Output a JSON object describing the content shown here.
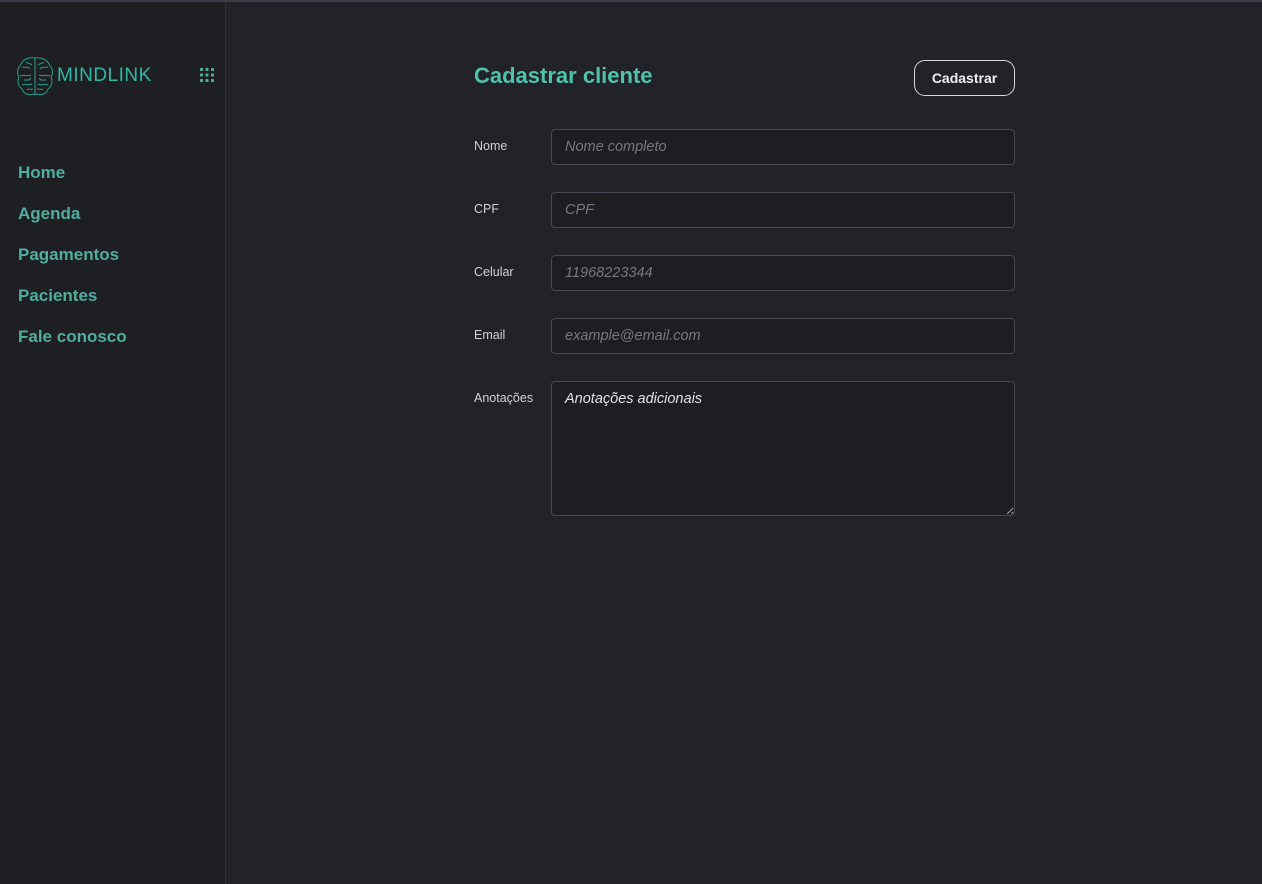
{
  "brand": {
    "name": "MINDLINK",
    "logo_icon": "brain-icon",
    "menu_icon": "grid-menu-icon",
    "accent_color": "#2fb8a4"
  },
  "sidebar": {
    "items": [
      {
        "label": "Home"
      },
      {
        "label": "Agenda"
      },
      {
        "label": "Pagamentos"
      },
      {
        "label": "Pacientes"
      },
      {
        "label": "Fale conosco"
      }
    ]
  },
  "form": {
    "title": "Cadastrar cliente",
    "submit_label": "Cadastrar",
    "fields": {
      "nome": {
        "label": "Nome",
        "placeholder": "Nome completo",
        "value": ""
      },
      "cpf": {
        "label": "CPF",
        "placeholder": "CPF",
        "value": ""
      },
      "celular": {
        "label": "Celular",
        "placeholder": "11968223344",
        "value": ""
      },
      "email": {
        "label": "Email",
        "placeholder": "example@email.com",
        "value": ""
      },
      "anotacoes": {
        "label": "Anotações",
        "placeholder": "Anotações adicionais",
        "value": ""
      }
    }
  }
}
